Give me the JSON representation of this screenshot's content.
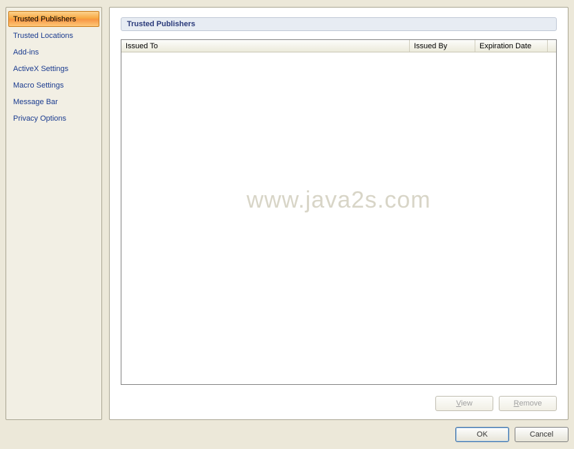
{
  "sidebar": {
    "items": [
      {
        "label": "Trusted Publishers"
      },
      {
        "label": "Trusted Locations"
      },
      {
        "label": "Add-ins"
      },
      {
        "label": "ActiveX Settings"
      },
      {
        "label": "Macro Settings"
      },
      {
        "label": "Message Bar"
      },
      {
        "label": "Privacy Options"
      }
    ],
    "selected_index": 0
  },
  "main": {
    "section_title": "Trusted Publishers",
    "table": {
      "columns": {
        "issued_to": "Issued To",
        "issued_by": "Issued By",
        "expiration": "Expiration Date"
      },
      "rows": []
    },
    "buttons": {
      "view": "View",
      "remove": "Remove"
    }
  },
  "dialog_buttons": {
    "ok": "OK",
    "cancel": "Cancel"
  },
  "watermark": "www.java2s.com"
}
